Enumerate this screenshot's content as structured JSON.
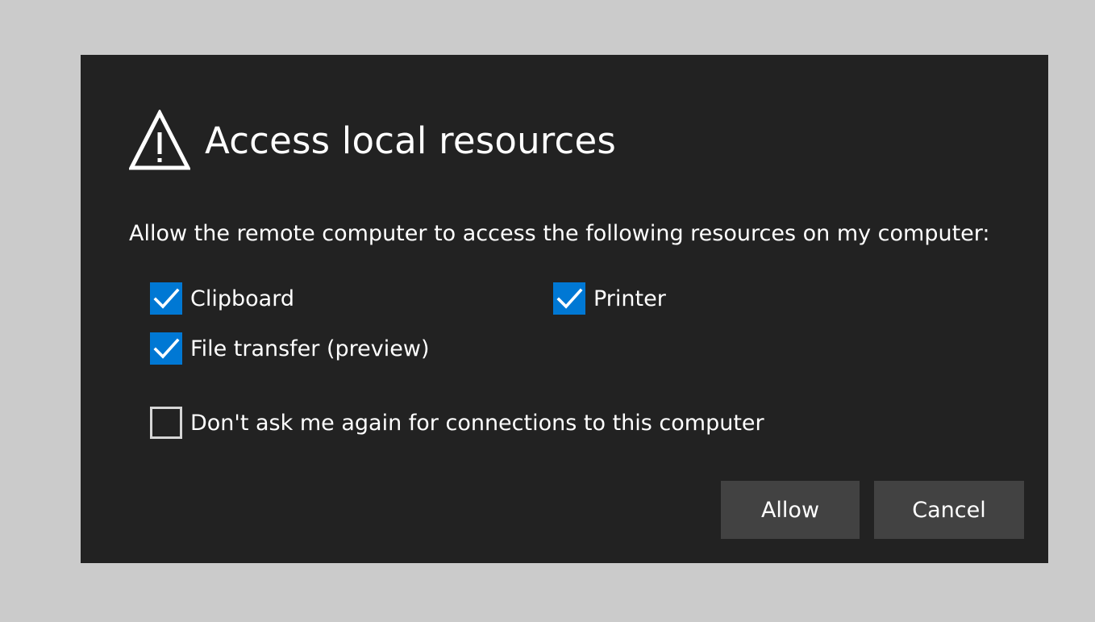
{
  "dialog": {
    "title": "Access local resources",
    "prompt": "Allow the remote computer to access the following resources on my computer:",
    "resources": [
      {
        "label": "Clipboard",
        "checked": true
      },
      {
        "label": "Printer",
        "checked": true
      },
      {
        "label": "File transfer (preview)",
        "checked": true
      }
    ],
    "dont_ask": {
      "label": "Don't ask me again for connections to this computer",
      "checked": false
    },
    "buttons": {
      "allow_label": "Allow",
      "cancel_label": "Cancel"
    }
  },
  "icons": {
    "header": "warning-icon",
    "checkbox_checked": "checkmark-icon"
  },
  "colors": {
    "page_background": "#cbcbcb",
    "dialog_background": "#222222",
    "accent": "#0078d4",
    "button_background": "#424242",
    "text": "#ffffff",
    "checkbox_border": "#d6d6d6"
  }
}
